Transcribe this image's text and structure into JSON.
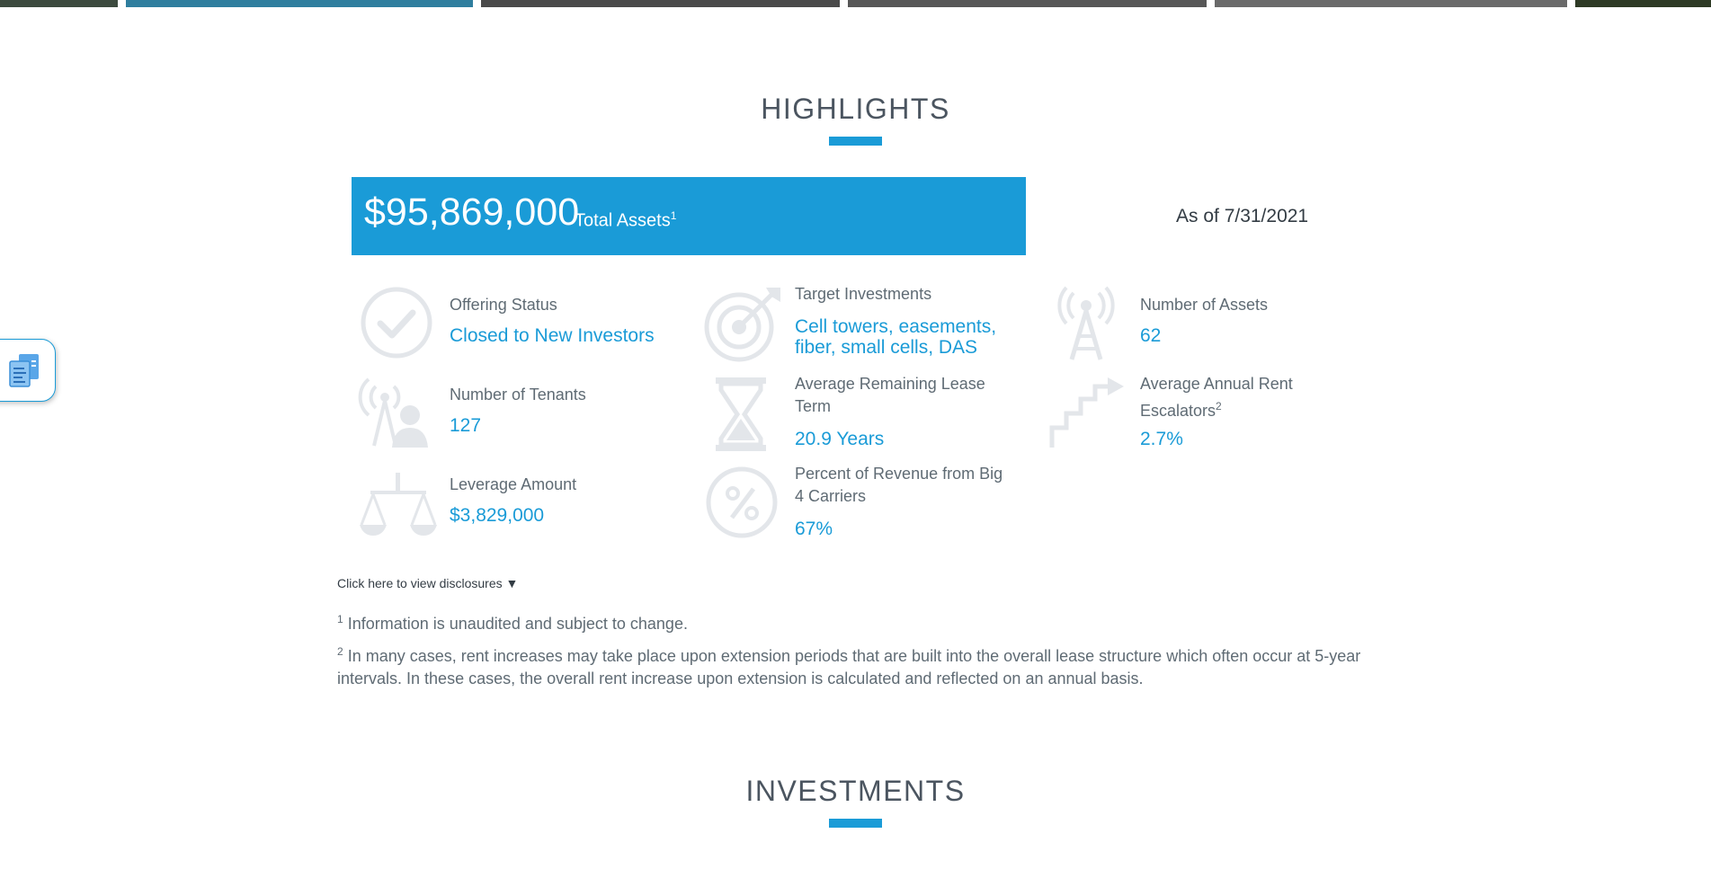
{
  "highlights": {
    "title": "HIGHLIGHTS",
    "total_assets_amount": "$95,869,000",
    "total_assets_label": "Total Assets",
    "total_assets_footnote": "1",
    "as_of": "As of 7/31/2021",
    "stats": [
      {
        "label": "Offering Status",
        "value": "Closed to New Investors",
        "icon": "checkmark-circle-icon"
      },
      {
        "label": "Target Investments",
        "value": "Cell towers, easements, fiber, small cells, DAS",
        "icon": "target-icon"
      },
      {
        "label": "Number of Assets",
        "value": "62",
        "icon": "cell-tower-icon"
      },
      {
        "label": "Number of Tenants",
        "value": "127",
        "icon": "tenant-tower-icon"
      },
      {
        "label": "Average Remaining Lease Term",
        "value": "20.9 Years",
        "icon": "hourglass-icon"
      },
      {
        "label": "Average Annual Rent Escalators",
        "label_footnote": "2",
        "value": "2.7%",
        "icon": "stairs-arrow-icon"
      },
      {
        "label": "Leverage Amount",
        "value": "$3,829,000",
        "icon": "scales-icon"
      },
      {
        "label": "Percent of Revenue from Big 4 Carriers",
        "value": "67%",
        "icon": "percent-circle-icon"
      }
    ]
  },
  "disclosures": {
    "toggle_label": "Click here to view disclosures ▼",
    "notes": [
      {
        "marker": "1",
        "text": "Information is unaudited and subject to change."
      },
      {
        "marker": "2",
        "text": "In many cases, rent increases may take place upon extension periods that are built into the overall lease structure which often occur at 5-year intervals. In these cases, the overall rent increase upon extension is calculated and reflected on an annual basis."
      }
    ]
  },
  "investments": {
    "title": "INVESTMENTS"
  },
  "widget": {
    "icon": "document-icon"
  },
  "colors": {
    "accent": "#1a9bd7",
    "title": "#4b5560",
    "body_text": "#5f6b74",
    "icon_gray": "#e3e6ea"
  }
}
